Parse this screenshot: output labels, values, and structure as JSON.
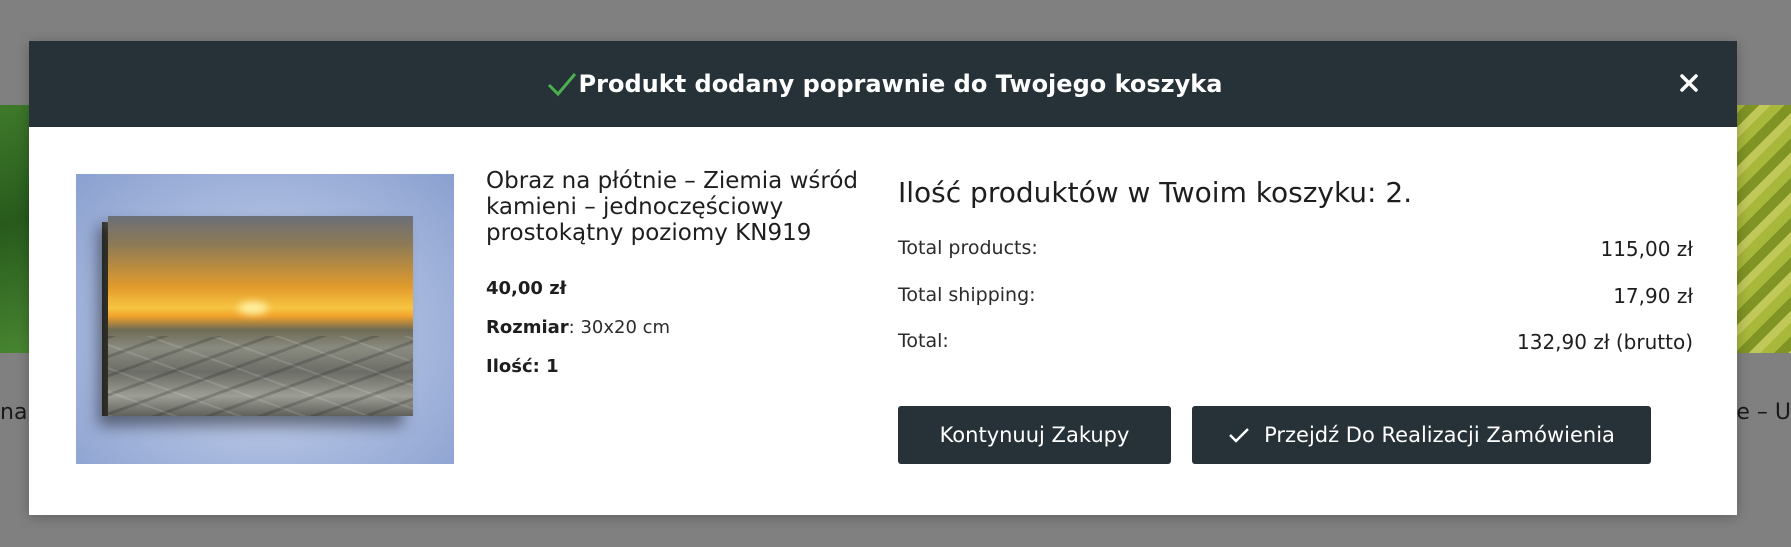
{
  "background_page": {
    "left_text": "na",
    "right_text": "ie – U"
  },
  "modal": {
    "header": {
      "title": "Produkt dodany poprawnie do Twojego koszyka",
      "close_icon": "close-icon",
      "check_icon": "check-icon"
    },
    "product": {
      "name": "Obraz na płótnie – Ziemia wśród kamieni – jednoczęściowy prostokątny poziomy KN919",
      "price": "40,00 zł",
      "size_label": "Rozmiar",
      "size_value": ": 30x20 cm",
      "quantity_text": "Ilość: 1"
    },
    "cart": {
      "heading": "Ilość produktów w Twoim koszyku: 2.",
      "rows": [
        {
          "label": "Total products:",
          "amount": "115,00 zł"
        },
        {
          "label": "Total shipping:",
          "amount": "17,90 zł"
        },
        {
          "label": "Total:",
          "amount": "132,90 zł (brutto)"
        }
      ]
    },
    "buttons": {
      "continue_label": "Kontynuuj Zakupy",
      "checkout_label": "Przejdź Do Realizacji Zamówienia"
    }
  },
  "colors": {
    "header_bg": "#263238",
    "button_bg": "#263238",
    "check_green": "#4caf50",
    "overlay": "#808080"
  }
}
